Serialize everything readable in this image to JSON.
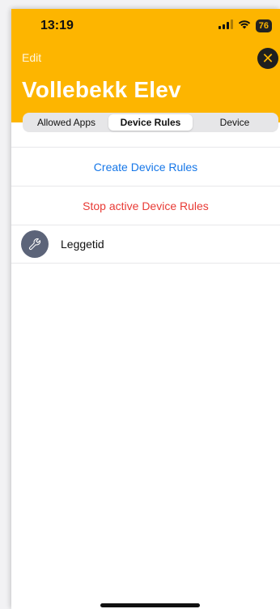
{
  "status_bar": {
    "time": "13:19",
    "battery": "76"
  },
  "header": {
    "edit_label": "Edit",
    "title": "Vollebekk Elev",
    "close_icon": "✕",
    "accent_color": "#fdb500"
  },
  "tabs": [
    {
      "label": "Allowed Apps",
      "active": false
    },
    {
      "label": "Device Rules",
      "active": true
    },
    {
      "label": "Device",
      "active": false
    }
  ],
  "actions": {
    "create_label": "Create Device Rules",
    "stop_label": "Stop active Device Rules"
  },
  "rules": [
    {
      "label": "Leggetid",
      "icon": "wrench-icon"
    }
  ]
}
